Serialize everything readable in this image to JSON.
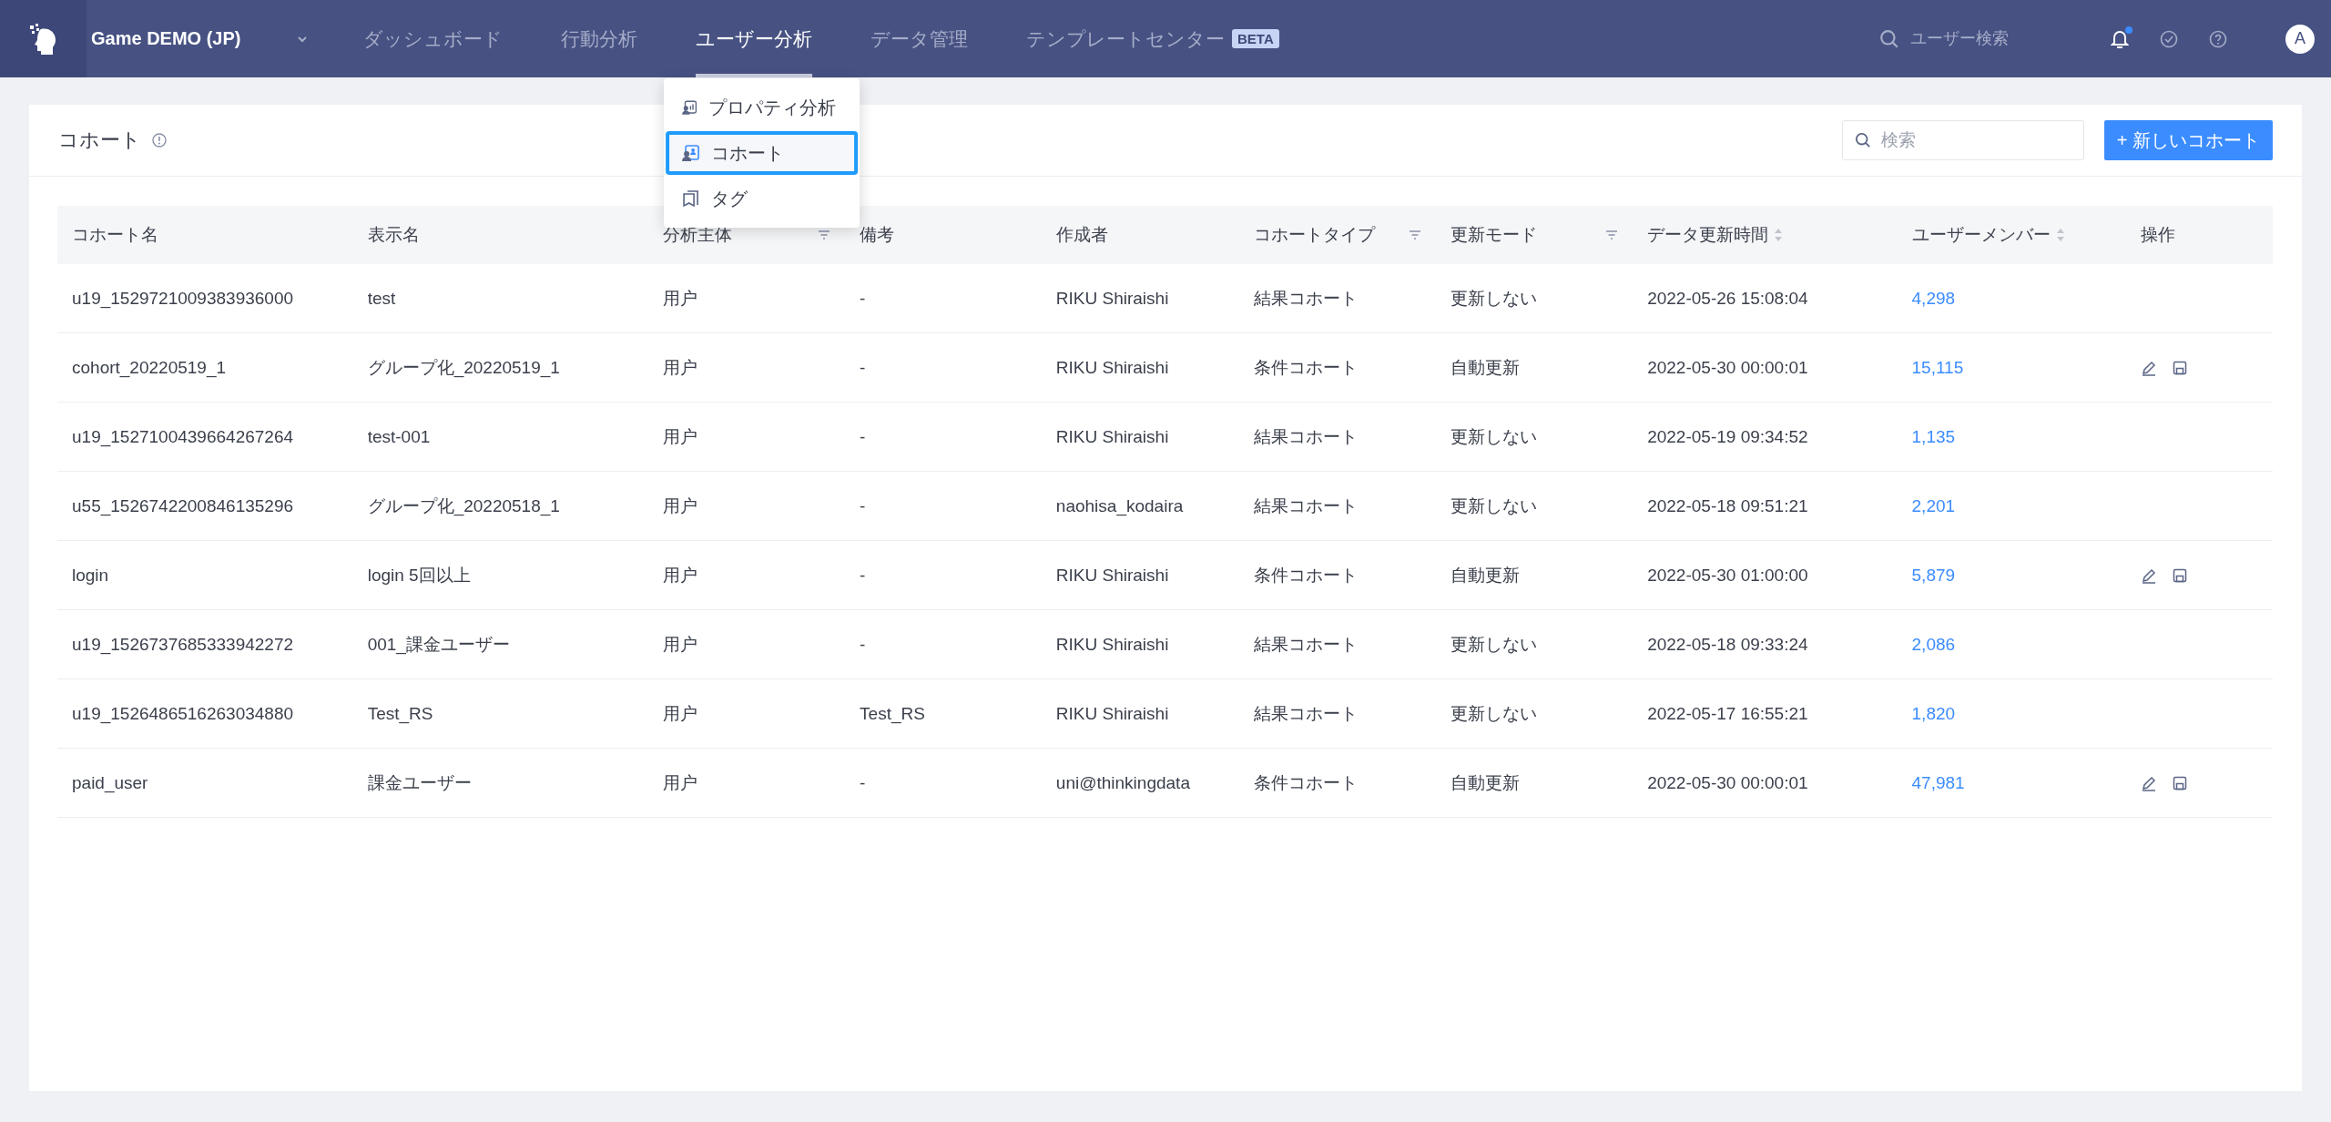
{
  "app": {
    "project": "Game DEMO (JP)"
  },
  "nav": {
    "items": [
      {
        "label": "ダッシュボード",
        "selected": false
      },
      {
        "label": "行動分析",
        "selected": false
      },
      {
        "label": "ユーザー分析",
        "selected": true
      },
      {
        "label": "データ管理",
        "selected": false
      },
      {
        "label": "テンプレートセンター",
        "selected": false,
        "badge": "BETA"
      }
    ],
    "search_placeholder": "ユーザー検索",
    "notification_unread": true,
    "avatar": "A"
  },
  "dropdown": {
    "items": [
      {
        "label": "プロパティ分析",
        "selected": false
      },
      {
        "label": "コホート",
        "selected": true
      },
      {
        "label": "タグ",
        "selected": false
      }
    ]
  },
  "page": {
    "title": "コホート",
    "search_placeholder": "検索",
    "new_button": "+ 新しいコホート"
  },
  "table": {
    "columns": [
      {
        "label": "コホート名",
        "kind": "plain"
      },
      {
        "label": "表示名",
        "kind": "plain"
      },
      {
        "label": "分析主体",
        "kind": "filter"
      },
      {
        "label": "備考",
        "kind": "plain"
      },
      {
        "label": "作成者",
        "kind": "plain"
      },
      {
        "label": "コホートタイプ",
        "kind": "filter"
      },
      {
        "label": "更新モード",
        "kind": "filter"
      },
      {
        "label": "データ更新時間",
        "kind": "sort"
      },
      {
        "label": "ユーザーメンバー",
        "kind": "sort"
      },
      {
        "label": "操作",
        "kind": "plain"
      }
    ],
    "rows": [
      {
        "cells": [
          "u19_1529721009383936000",
          "test",
          "用户",
          "-",
          "RIKU Shiraishi",
          "結果コホート",
          "更新しない",
          "2022-05-26 15:08:04",
          "4,298"
        ],
        "editable": false
      },
      {
        "cells": [
          "cohort_20220519_1",
          "グループ化_20220519_1",
          "用户",
          "-",
          "RIKU Shiraishi",
          "条件コホート",
          "自動更新",
          "2022-05-30 00:00:01",
          "15,115"
        ],
        "editable": true
      },
      {
        "cells": [
          "u19_1527100439664267264",
          "test-001",
          "用户",
          "-",
          "RIKU Shiraishi",
          "結果コホート",
          "更新しない",
          "2022-05-19 09:34:52",
          "1,135"
        ],
        "editable": false
      },
      {
        "cells": [
          "u55_1526742200846135296",
          "グループ化_20220518_1",
          "用户",
          "-",
          "naohisa_kodaira",
          "結果コホート",
          "更新しない",
          "2022-05-18 09:51:21",
          "2,201"
        ],
        "editable": false
      },
      {
        "cells": [
          "login",
          "login 5回以上",
          "用户",
          "-",
          "RIKU Shiraishi",
          "条件コホート",
          "自動更新",
          "2022-05-30 01:00:00",
          "5,879"
        ],
        "editable": true
      },
      {
        "cells": [
          "u19_1526737685333942272",
          "001_課金ユーザー",
          "用户",
          "-",
          "RIKU Shiraishi",
          "結果コホート",
          "更新しない",
          "2022-05-18 09:33:24",
          "2,086"
        ],
        "editable": false
      },
      {
        "cells": [
          "u19_1526486516263034880",
          "Test_RS",
          "用户",
          "Test_RS",
          "RIKU Shiraishi",
          "結果コホート",
          "更新しない",
          "2022-05-17 16:55:21",
          "1,820"
        ],
        "editable": false
      },
      {
        "cells": [
          "paid_user",
          "課金ユーザー",
          "用户",
          "-",
          "uni@thinkingdata",
          "条件コホート",
          "自動更新",
          "2022-05-30 00:00:01",
          "47,981"
        ],
        "editable": true
      }
    ]
  }
}
